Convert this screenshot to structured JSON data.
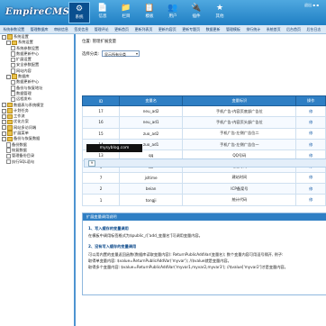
{
  "app": {
    "logo": "EmpireCMS"
  },
  "topnav": {
    "items": [
      {
        "label": "系统",
        "icon": "⚙"
      },
      {
        "label": "信息",
        "icon": "📄"
      },
      {
        "label": "栏目",
        "icon": "📁"
      },
      {
        "label": "模板",
        "icon": "📋"
      },
      {
        "label": "用户",
        "icon": "👥"
      },
      {
        "label": "插件",
        "icon": "🔌"
      },
      {
        "label": "其他",
        "icon": "★"
      }
    ],
    "links": "退出  ▪  ▪"
  },
  "subnav": {
    "items": [
      "系统参数设置",
      "管理数据库",
      "审核信息",
      "签发信息",
      "管理评论",
      "更新首页",
      "更新列表页",
      "更新内容页",
      "更新专题页",
      "数据更新",
      "管理模板",
      "排行统计",
      "系统首页",
      "后台首页",
      "后台日志"
    ]
  },
  "sidebar": {
    "items": [
      {
        "label": "系统设置",
        "level": 0,
        "type": "box-folder"
      },
      {
        "label": "系统设置",
        "level": 1,
        "type": "box-folder"
      },
      {
        "label": "系统参数设置",
        "level": 2,
        "type": "page"
      },
      {
        "label": "数据更新中心",
        "level": 2,
        "type": "page"
      },
      {
        "label": "扩展设置",
        "level": 2,
        "type": "page"
      },
      {
        "label": "安全参数配置",
        "level": 2,
        "type": "page"
      },
      {
        "label": "网站内容",
        "level": 2,
        "type": "page"
      },
      {
        "label": "数据库",
        "level": 1,
        "type": "box-folder"
      },
      {
        "label": "数据更新中心",
        "level": 2,
        "type": "page"
      },
      {
        "label": "备份与恢复地址",
        "level": 2,
        "type": "page"
      },
      {
        "label": "数据管理",
        "level": 2,
        "type": "page"
      },
      {
        "label": "远程发布",
        "level": 2,
        "type": "page"
      },
      {
        "label": "数据表与系统模型",
        "level": 0,
        "type": "box-folder"
      },
      {
        "label": "计划任务",
        "level": 0,
        "type": "box-folder"
      },
      {
        "label": "工作流",
        "level": 0,
        "type": "box-folder"
      },
      {
        "label": "优化方案",
        "level": 0,
        "type": "box-folder"
      },
      {
        "label": "网站多访问端",
        "level": 0,
        "type": "box-folder"
      },
      {
        "label": "扩展菜单",
        "level": 0,
        "type": "box-folder"
      },
      {
        "label": "备份与恢复数据",
        "level": 0,
        "type": "box-folder"
      },
      {
        "label": "备份数据",
        "level": 1,
        "type": "page"
      },
      {
        "label": "恢复数据",
        "level": 1,
        "type": "page"
      },
      {
        "label": "管理备份目录",
        "level": 1,
        "type": "page"
      },
      {
        "label": "执行SQL语句",
        "level": 1,
        "type": "page"
      }
    ]
  },
  "main": {
    "breadcrumb": "位置: 管理扩展变量",
    "select_label": "选择分类:",
    "select_value": "显示所有分类",
    "table": {
      "headers": [
        "ID",
        "变量名",
        "变量标识",
        "操作"
      ],
      "rows": [
        {
          "id": "17",
          "name": "neu_ad2",
          "label": "手机广告-内容页底部广告位",
          "op": "修"
        },
        {
          "id": "16",
          "name": "neu_ad1",
          "label": "手机广告-内容页头部广告位",
          "op": "修"
        },
        {
          "id": "15",
          "name": "zuo_ad2",
          "label": "手机广告-左侧广告位二",
          "op": "修"
        },
        {
          "id": "14",
          "name": "zuo_ad1",
          "label": "手机广告-左侧广告位一",
          "op": "修"
        },
        {
          "id": "13",
          "name": "qq",
          "label": "QQ号码",
          "op": "修"
        },
        {
          "id": "9",
          "name": "tel",
          "label": "电话号码",
          "op": "修"
        },
        {
          "id": "7",
          "name": "jsltime",
          "label": "建站时间",
          "op": "修"
        },
        {
          "id": "2",
          "name": "beian",
          "label": "ICP备案号",
          "op": "修"
        },
        {
          "id": "1",
          "name": "tongji",
          "label": "统计代码",
          "op": "修"
        }
      ]
    },
    "pager": "9",
    "watermark": "mysyblog.com",
    "help": {
      "title": "扩展变量调用说明",
      "h1": "1、写入缓存的变量调用",
      "l1": "在模板中调用标签格式为$public_r['add_变量名']可调用变量内容。",
      "h2": "2、没有写入缓存的变量调用",
      "l2": "可以用内置的变量返回函数(数据库读取变量内容): ReturnPublicAddVar(变量名); 数个变量内容可用逗号隔开, 例子:",
      "l3": "取得单变量内容: $value=ReturnPublicAddVar('myvar'); //$value就是变量内容。",
      "l4": "取得多个变量内容: $value=ReturnPublicAddVar('myvar1,myvar2,myvar3'); //$value['myvar2']才是变量内容。"
    }
  },
  "colors": {
    "accent": "#2f7fc4",
    "topbar": "#1f7fc4",
    "sidebar_border": "#4d94d1"
  }
}
